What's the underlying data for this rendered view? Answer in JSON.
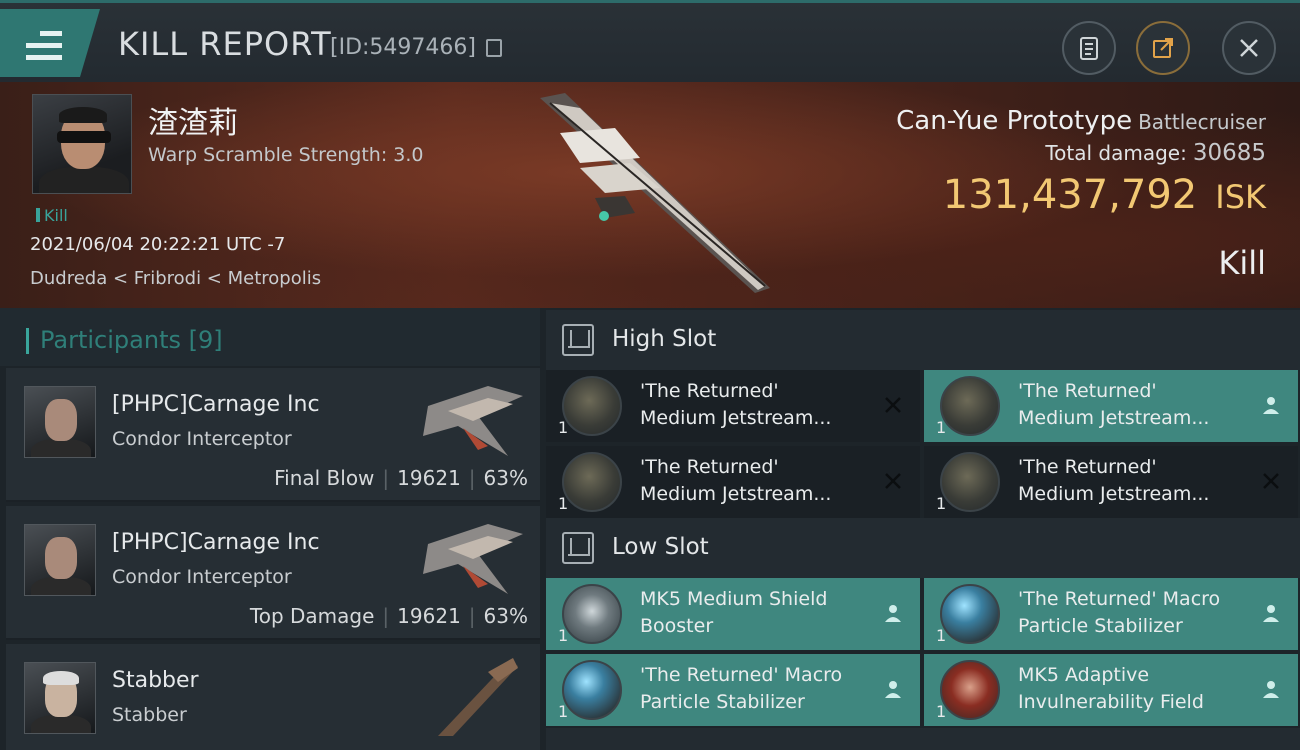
{
  "header": {
    "title": "KILL REPORT",
    "report_id": "[ID:5497466]",
    "icons": [
      "menu-icon",
      "copy-icon",
      "clipboard-icon",
      "share-icon",
      "close-icon"
    ]
  },
  "victim": {
    "name": "渣渣莉",
    "scramble": "Warp Scramble Strength: 3.0",
    "tag": "Kill",
    "datetime": "2021/06/04 20:22:21 UTC -7",
    "location": "Dudreda < Fribrodi < Metropolis"
  },
  "ship": {
    "name": "Can-Yue Prototype",
    "class": "Battlecruiser",
    "damage_label": "Total damage:",
    "damage": "30685",
    "isk_value": "131,437,792",
    "isk_unit": "ISK",
    "result": "Kill"
  },
  "participants": {
    "label": "Participants",
    "count": "[9]",
    "rows": [
      {
        "name": "[PHPC]Carnage Inc",
        "ship": "Condor Interceptor",
        "role": "Final Blow",
        "damage": "19621",
        "percent": "63%"
      },
      {
        "name": "[PHPC]Carnage Inc",
        "ship": "Condor Interceptor",
        "role": "Top Damage",
        "damage": "19621",
        "percent": "63%"
      },
      {
        "name": "Stabber",
        "ship": "Stabber"
      }
    ]
  },
  "slots": {
    "high": {
      "label": "High Slot",
      "modules": [
        {
          "qty": "1",
          "line1": "'The Returned'",
          "line2": "Medium Jetstream...",
          "status": "destroyed"
        },
        {
          "qty": "1",
          "line1": "'The Returned'",
          "line2": "Medium Jetstream...",
          "status": "dropped"
        },
        {
          "qty": "1",
          "line1": "'The Returned'",
          "line2": "Medium Jetstream...",
          "status": "destroyed"
        },
        {
          "qty": "1",
          "line1": "'The Returned'",
          "line2": "Medium Jetstream...",
          "status": "destroyed"
        }
      ]
    },
    "low": {
      "label": "Low Slot",
      "modules": [
        {
          "qty": "1",
          "line1": "MK5 Medium Shield",
          "line2": "Booster",
          "status": "dropped"
        },
        {
          "qty": "1",
          "line1": "'The Returned' Macro",
          "line2": "Particle Stabilizer",
          "status": "dropped"
        },
        {
          "qty": "1",
          "line1": "'The Returned' Macro",
          "line2": "Particle Stabilizer",
          "status": "dropped"
        },
        {
          "qty": "1",
          "line1": "MK5 Adaptive",
          "line2": "Invulnerability Field",
          "status": "dropped"
        }
      ]
    }
  },
  "colors": {
    "accent": "#3f877f",
    "isk": "#f2c873",
    "teal_text": "#2f7f79"
  }
}
